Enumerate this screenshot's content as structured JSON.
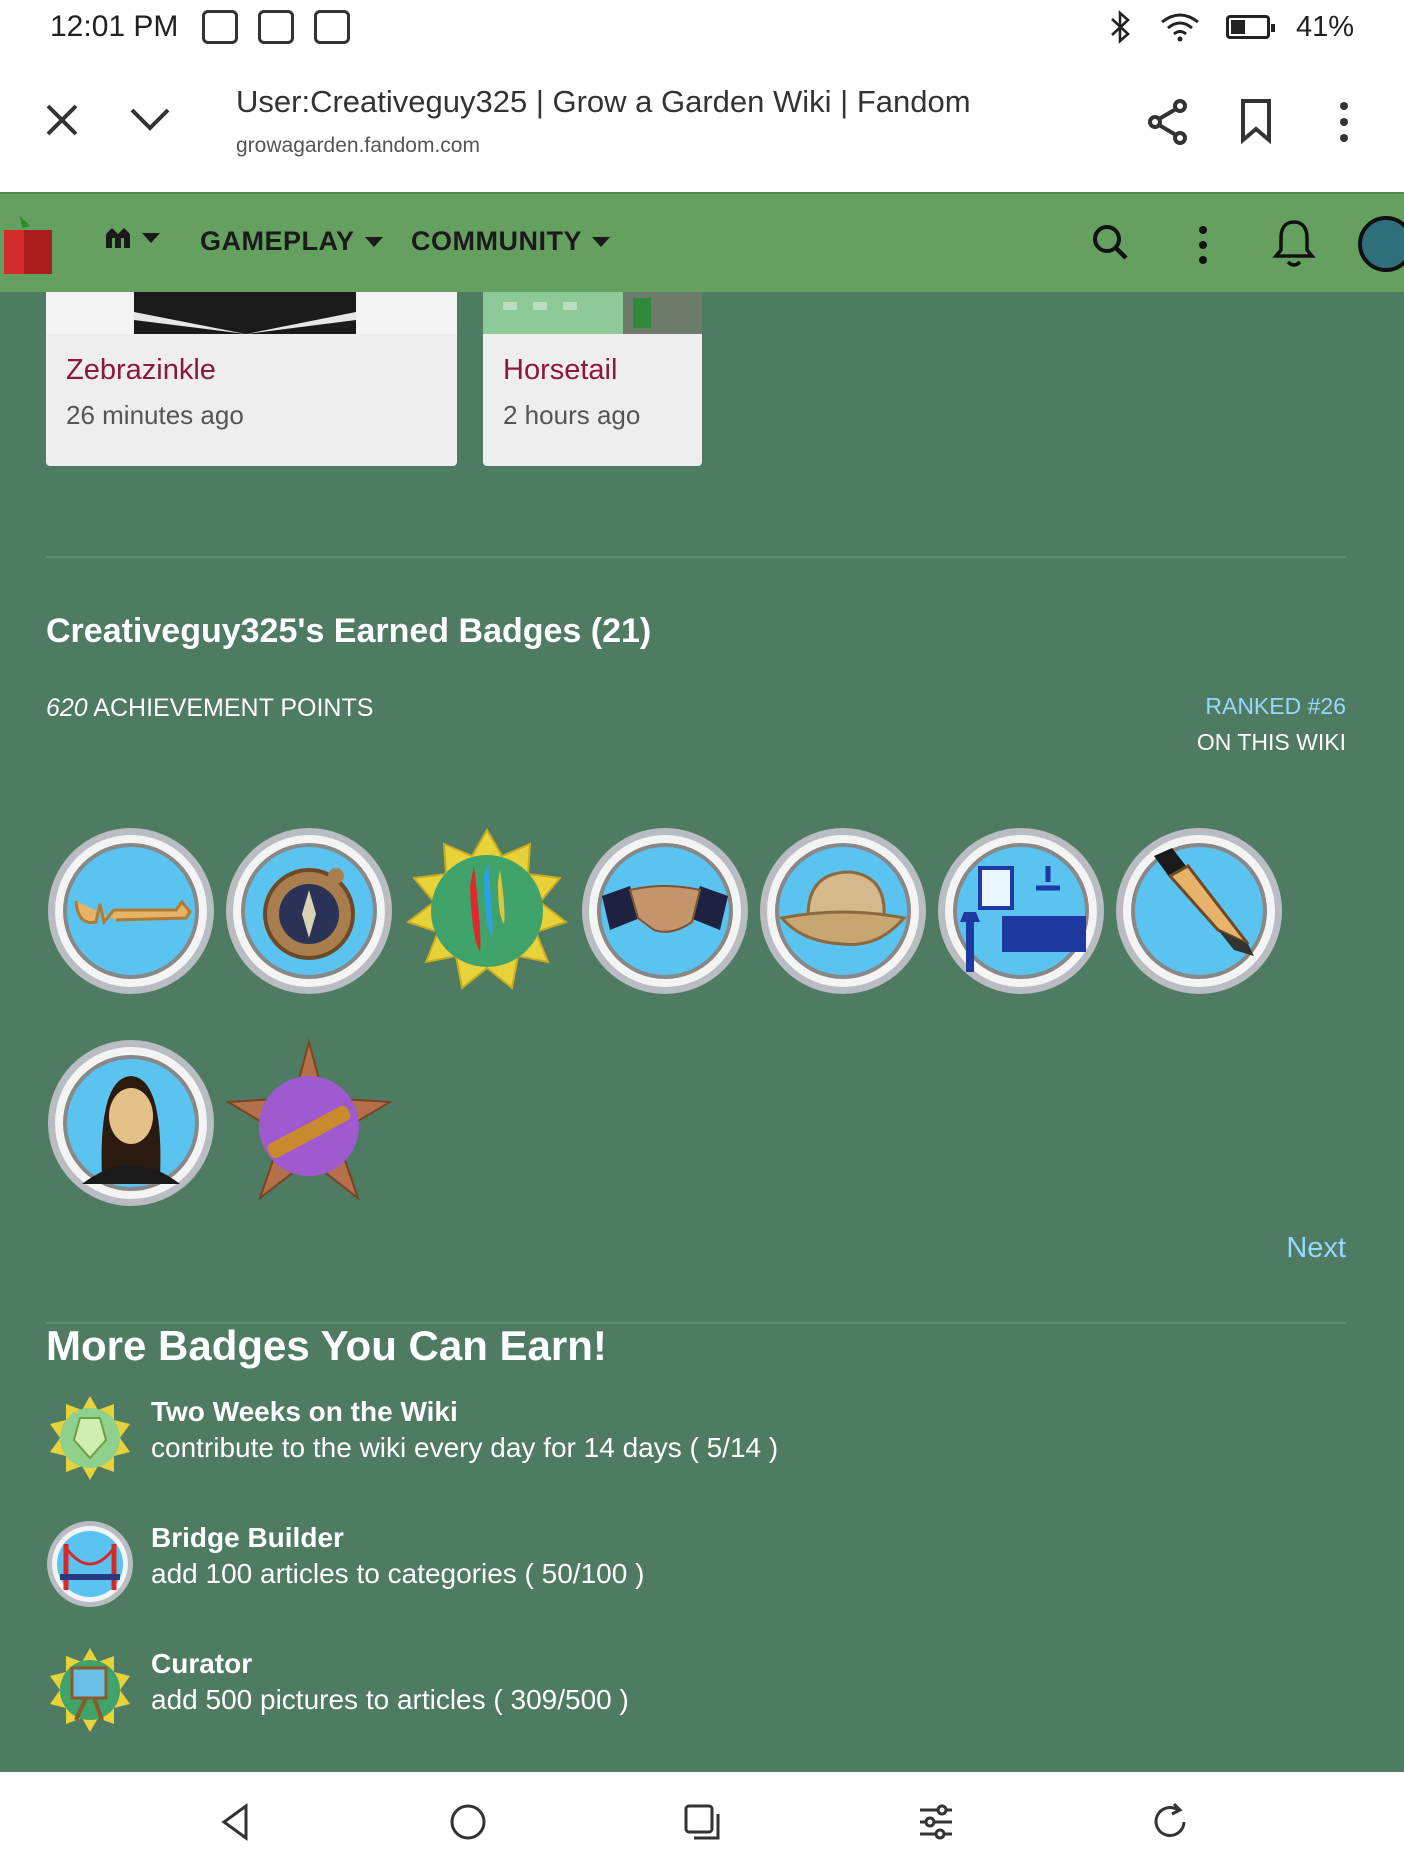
{
  "status_bar": {
    "time": "12:01 PM",
    "battery": "41%"
  },
  "browser": {
    "title": "User:Creativeguy325 | Grow a Garden Wiki | Fandom",
    "url": "growagarden.fandom.com"
  },
  "nav": {
    "items": [
      "GAMEPLAY",
      "COMMUNITY"
    ]
  },
  "recent_cards": [
    {
      "name": "Zebrazinkle",
      "time": "26 minutes ago"
    },
    {
      "name": "Horsetail",
      "time": "2 hours ago"
    }
  ],
  "badges_section": {
    "title": "Creativeguy325's Earned Badges (21)",
    "points_value": "620",
    "points_label": "ACHIEVEMENT POINTS",
    "rank_line1": "RANKED #26",
    "rank_line2": "ON THIS WIKI",
    "next_label": "Next",
    "badge_icons": [
      "key-icon",
      "compass-icon",
      "paint-drip-icon",
      "handshake-icon",
      "pith-helmet-icon",
      "room-furniture-icon",
      "pen-nib-icon",
      "portrait-icon",
      "spyglass-icon"
    ]
  },
  "more_badges": {
    "title": "More Badges You Can Earn!",
    "items": [
      {
        "title": "Two Weeks on the Wiki",
        "desc": "contribute to the wiki every day for 14 days ( 5/14 )",
        "icon": "calendar-crystal-icon"
      },
      {
        "title": "Bridge Builder",
        "desc": "add 100 articles to categories ( 50/100 )",
        "icon": "bridge-icon"
      },
      {
        "title": "Curator",
        "desc": "add 500 pictures to articles ( 309/500 )",
        "icon": "easel-icon"
      }
    ]
  },
  "colors": {
    "page_bg": "#4e7b61",
    "nav_bg": "#66a060",
    "link_blue": "#9ad7ff",
    "card_name": "#8c1740"
  }
}
